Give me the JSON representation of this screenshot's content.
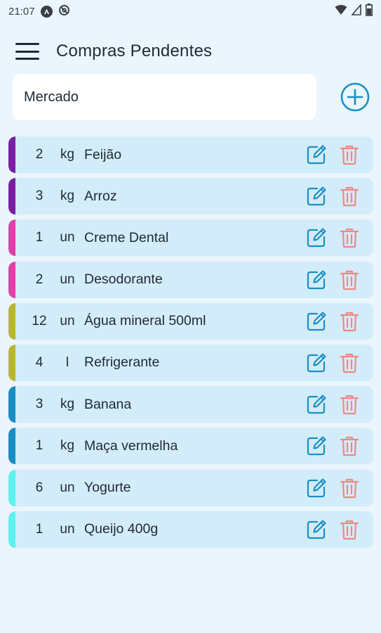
{
  "status_bar": {
    "time": "21:07"
  },
  "app_bar": {
    "title": "Compras Pendentes",
    "menu_icon": "hamburger-menu-icon"
  },
  "input": {
    "value": "Mercado",
    "add_icon": "add-circle-icon"
  },
  "colors": {
    "accent": "#1a8fc6",
    "delete": "#ec8a83",
    "item_bg": "#d3ecfa"
  },
  "items": [
    {
      "qty": "2",
      "unit": "kg",
      "name": "Feijão",
      "color": "#7b1fa2"
    },
    {
      "qty": "3",
      "unit": "kg",
      "name": "Arroz",
      "color": "#7b1fa2"
    },
    {
      "qty": "1",
      "unit": "un",
      "name": "Creme Dental",
      "color": "#e040a8"
    },
    {
      "qty": "2",
      "unit": "un",
      "name": "Desodorante",
      "color": "#e040a8"
    },
    {
      "qty": "12",
      "unit": "un",
      "name": "Água mineral 500ml",
      "color": "#b9b530"
    },
    {
      "qty": "4",
      "unit": "l",
      "name": "Refrigerante",
      "color": "#b9b530"
    },
    {
      "qty": "3",
      "unit": "kg",
      "name": "Banana",
      "color": "#1a8cc4"
    },
    {
      "qty": "1",
      "unit": "kg",
      "name": "Maça vermelha",
      "color": "#1a8cc4"
    },
    {
      "qty": "6",
      "unit": "un",
      "name": "Yogurte",
      "color": "#5ef0ee"
    },
    {
      "qty": "1",
      "unit": "un",
      "name": "Queijo 400g",
      "color": "#5ef0ee"
    }
  ]
}
